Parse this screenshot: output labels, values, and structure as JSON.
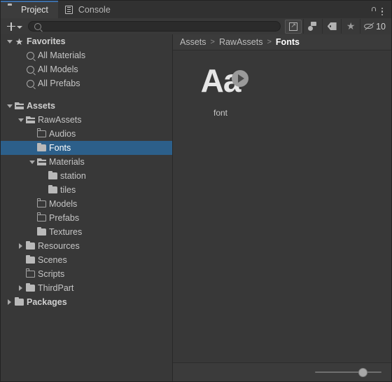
{
  "window": {
    "tabs": [
      {
        "label": "Project",
        "icon": "folder-icon",
        "active": true
      },
      {
        "label": "Console",
        "icon": "console-lines-icon",
        "active": false
      }
    ],
    "lock_icon": "unlocked-padlock-icon",
    "menu_icon": "kebab-menu-icon"
  },
  "toolbar": {
    "create_label": "+",
    "create_dropdown_icon": "chevron-down-icon",
    "search": {
      "value": "",
      "placeholder": "",
      "icon": "search-icon"
    },
    "filters": [
      {
        "name": "expand-collapse-toggle",
        "icon": "expand-arrows-icon",
        "active": true
      },
      {
        "name": "filter-by-type",
        "icon": "shape-type-icon",
        "active": false
      },
      {
        "name": "filter-by-label",
        "icon": "tag-icon",
        "active": false
      },
      {
        "name": "filter-by-favorite",
        "icon": "star-icon",
        "active": false
      }
    ],
    "hidden_count": "10",
    "hidden_icon": "eye-crossed-icon"
  },
  "tree": [
    {
      "label": "Favorites",
      "depth": 0,
      "twisty": "down",
      "icon": "star-icon",
      "bold": true,
      "selected": false
    },
    {
      "label": "All Materials",
      "depth": 1,
      "twisty": "none",
      "icon": "search-icon",
      "bold": false,
      "selected": false
    },
    {
      "label": "All Models",
      "depth": 1,
      "twisty": "none",
      "icon": "search-icon",
      "bold": false,
      "selected": false
    },
    {
      "label": "All Prefabs",
      "depth": 1,
      "twisty": "none",
      "icon": "search-icon",
      "bold": false,
      "selected": false
    },
    {
      "label": "",
      "depth": 0,
      "twisty": "none",
      "icon": "spacer",
      "bold": false,
      "selected": false
    },
    {
      "label": "Assets",
      "depth": 0,
      "twisty": "down",
      "icon": "folder-open-icon",
      "bold": true,
      "selected": false
    },
    {
      "label": "RawAssets",
      "depth": 1,
      "twisty": "down",
      "icon": "folder-open-icon",
      "bold": false,
      "selected": false
    },
    {
      "label": "Audios",
      "depth": 2,
      "twisty": "none",
      "icon": "folder-empty-icon",
      "bold": false,
      "selected": false
    },
    {
      "label": "Fonts",
      "depth": 2,
      "twisty": "none",
      "icon": "folder-filled-icon",
      "bold": false,
      "selected": true
    },
    {
      "label": "Materials",
      "depth": 2,
      "twisty": "down",
      "icon": "folder-open-icon",
      "bold": false,
      "selected": false
    },
    {
      "label": "station",
      "depth": 3,
      "twisty": "none",
      "icon": "folder-filled-icon",
      "bold": false,
      "selected": false
    },
    {
      "label": "tiles",
      "depth": 3,
      "twisty": "none",
      "icon": "folder-filled-icon",
      "bold": false,
      "selected": false
    },
    {
      "label": "Models",
      "depth": 2,
      "twisty": "none",
      "icon": "folder-empty-icon",
      "bold": false,
      "selected": false
    },
    {
      "label": "Prefabs",
      "depth": 2,
      "twisty": "none",
      "icon": "folder-empty-icon",
      "bold": false,
      "selected": false
    },
    {
      "label": "Textures",
      "depth": 2,
      "twisty": "none",
      "icon": "folder-filled-icon",
      "bold": false,
      "selected": false
    },
    {
      "label": "Resources",
      "depth": 1,
      "twisty": "right",
      "icon": "folder-filled-icon",
      "bold": false,
      "selected": false
    },
    {
      "label": "Scenes",
      "depth": 1,
      "twisty": "none",
      "icon": "folder-filled-icon",
      "bold": false,
      "selected": false
    },
    {
      "label": "Scripts",
      "depth": 1,
      "twisty": "none",
      "icon": "folder-empty-icon",
      "bold": false,
      "selected": false
    },
    {
      "label": "ThirdPart",
      "depth": 1,
      "twisty": "right",
      "icon": "folder-filled-icon",
      "bold": false,
      "selected": false
    },
    {
      "label": "Packages",
      "depth": 0,
      "twisty": "right",
      "icon": "folder-filled-icon",
      "bold": true,
      "selected": false
    }
  ],
  "breadcrumb": [
    {
      "label": "Assets",
      "current": false
    },
    {
      "label": "RawAssets",
      "current": false
    },
    {
      "label": "Fonts",
      "current": true
    }
  ],
  "breadcrumb_separator": ">",
  "assets": [
    {
      "label": "font",
      "preview_text": "Aa",
      "badge": "play-icon",
      "selected": false
    }
  ],
  "annotation": {
    "type": "arrow",
    "color": "#e81c1c",
    "points_to": "font-asset-thumbnail"
  },
  "zoom_slider": {
    "value": 75,
    "min": 0,
    "max": 100
  },
  "colors": {
    "selection": "#2c5f8a",
    "window_bg": "#383838",
    "tab_bg": "#313131",
    "accent": "#3d6fa8",
    "annotation_red": "#e81c1c"
  }
}
